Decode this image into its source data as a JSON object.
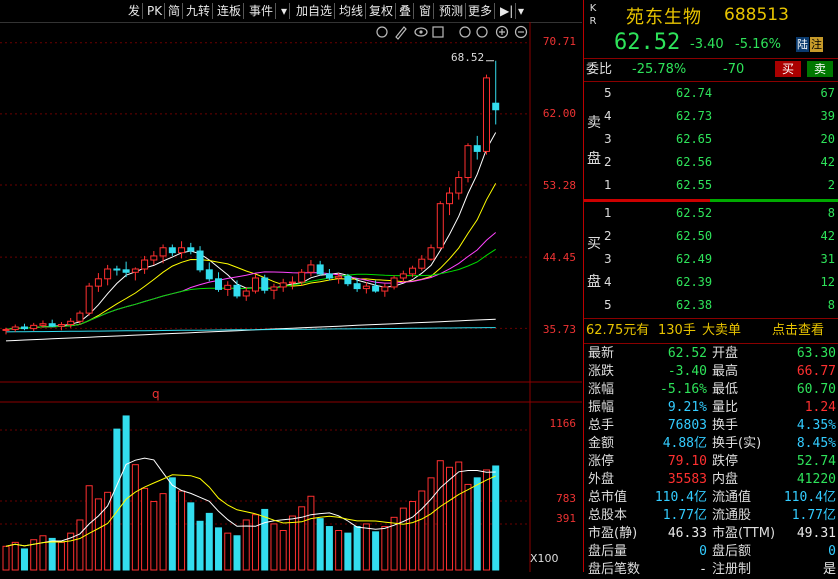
{
  "toolbar": {
    "items": [
      "发",
      "PK",
      "简",
      "九转",
      "连板",
      "事件",
      "▾",
      "加自选",
      "均线",
      "复权",
      "叠",
      "窗",
      "预测",
      "更多",
      "▶|",
      "▾"
    ]
  },
  "chart": {
    "price_ticks": [
      "70.71",
      "62.00",
      "53.28",
      "44.45",
      "35.73"
    ],
    "vol_ticks": [
      "1166",
      "783",
      "391"
    ],
    "high_label": "68.52",
    "q_marker": "q",
    "vol_unit": "X100"
  },
  "chart_data": {
    "type": "candlestick",
    "ylim": [
      31.0,
      73.0
    ],
    "candles": [
      [
        35.5,
        35.8,
        35.0,
        35.6
      ],
      [
        35.6,
        36.2,
        35.3,
        35.9
      ],
      [
        35.9,
        36.3,
        35.5,
        35.7
      ],
      [
        35.7,
        36.4,
        35.4,
        36.1
      ],
      [
        36.1,
        36.7,
        35.8,
        36.3
      ],
      [
        36.3,
        36.8,
        35.9,
        36.0
      ],
      [
        36.0,
        36.5,
        35.5,
        36.2
      ],
      [
        36.2,
        37.0,
        35.8,
        36.6
      ],
      [
        36.6,
        37.9,
        36.2,
        37.6
      ],
      [
        37.6,
        41.3,
        37.3,
        40.9
      ],
      [
        40.9,
        42.5,
        40.2,
        41.8
      ],
      [
        41.8,
        43.5,
        41.0,
        43.0
      ],
      [
        43.0,
        43.4,
        42.2,
        42.9
      ],
      [
        42.9,
        43.9,
        42.0,
        42.6
      ],
      [
        42.6,
        43.2,
        41.6,
        43.0
      ],
      [
        43.0,
        44.6,
        42.4,
        44.1
      ],
      [
        44.1,
        45.2,
        43.5,
        44.6
      ],
      [
        44.6,
        46.0,
        43.7,
        45.6
      ],
      [
        45.6,
        46.0,
        44.6,
        45.0
      ],
      [
        45.0,
        46.4,
        44.3,
        45.6
      ],
      [
        45.6,
        46.2,
        44.8,
        45.2
      ],
      [
        45.2,
        45.8,
        42.6,
        42.9
      ],
      [
        42.9,
        43.8,
        41.5,
        41.8
      ],
      [
        41.8,
        42.6,
        40.2,
        40.5
      ],
      [
        40.5,
        41.5,
        39.7,
        41.0
      ],
      [
        41.0,
        41.6,
        39.4,
        39.7
      ],
      [
        39.7,
        40.8,
        39.1,
        40.3
      ],
      [
        40.3,
        42.3,
        40.0,
        41.9
      ],
      [
        41.9,
        42.3,
        40.0,
        40.4
      ],
      [
        40.4,
        41.2,
        39.3,
        40.8
      ],
      [
        40.8,
        41.8,
        40.2,
        41.3
      ],
      [
        41.3,
        42.1,
        40.5,
        41.4
      ],
      [
        41.4,
        43.0,
        41.0,
        42.6
      ],
      [
        42.6,
        44.1,
        42.1,
        43.5
      ],
      [
        43.5,
        44.0,
        42.2,
        42.4
      ],
      [
        42.4,
        43.0,
        41.6,
        41.9
      ],
      [
        41.9,
        42.5,
        41.2,
        42.1
      ],
      [
        42.1,
        42.4,
        40.9,
        41.2
      ],
      [
        41.2,
        41.9,
        40.2,
        40.6
      ],
      [
        40.6,
        41.4,
        40.0,
        40.9
      ],
      [
        40.9,
        41.6,
        40.1,
        40.3
      ],
      [
        40.3,
        41.2,
        39.6,
        40.8
      ],
      [
        40.8,
        42.2,
        40.5,
        41.9
      ],
      [
        41.9,
        42.8,
        41.4,
        42.4
      ],
      [
        42.4,
        43.4,
        42.0,
        43.1
      ],
      [
        43.1,
        44.7,
        42.8,
        44.2
      ],
      [
        44.2,
        46.0,
        44.0,
        45.6
      ],
      [
        45.6,
        51.3,
        45.4,
        51.0
      ],
      [
        51.0,
        53.0,
        49.6,
        52.3
      ],
      [
        52.3,
        55.0,
        51.5,
        54.2
      ],
      [
        54.2,
        58.4,
        53.6,
        58.1
      ],
      [
        58.1,
        59.3,
        56.4,
        57.4
      ],
      [
        57.4,
        66.8,
        57.0,
        66.4
      ],
      [
        63.3,
        68.5,
        60.7,
        62.5
      ]
    ],
    "volumes": [
      180,
      210,
      160,
      230,
      260,
      240,
      210,
      280,
      380,
      640,
      540,
      590,
      1070,
      1170,
      800,
      620,
      520,
      580,
      700,
      600,
      510,
      370,
      430,
      320,
      280,
      260,
      380,
      420,
      460,
      350,
      300,
      410,
      480,
      560,
      390,
      330,
      300,
      280,
      330,
      350,
      290,
      330,
      400,
      470,
      520,
      600,
      700,
      830,
      780,
      820,
      650,
      700,
      760,
      790
    ],
    "ma5_color": "#ffffff",
    "ma10_color": "#ffff00",
    "ma20_color": "#ff44ff",
    "ma30_color": "#00dd00",
    "ma60_color": "#ffffff"
  },
  "panel": {
    "kr_label": "K R",
    "name": "苑东生物",
    "code": "688513",
    "price": "62.52",
    "change": "-3.40",
    "change_pct": "-5.16%",
    "badge_lu": "陆",
    "badge_zhu": "注",
    "weibi_label": "委比",
    "weibi_pct": "-25.78%",
    "weibi_val": "-70",
    "buy_btn": "买",
    "sell_btn": "卖",
    "sell_label_1": "卖",
    "sell_label_2": "盘",
    "buy_label_1": "买",
    "buy_label_2": "盘",
    "asks": [
      {
        "level": "5",
        "price": "62.74",
        "vol": "67"
      },
      {
        "level": "4",
        "price": "62.73",
        "vol": "39"
      },
      {
        "level": "3",
        "price": "62.65",
        "vol": "20"
      },
      {
        "level": "2",
        "price": "62.56",
        "vol": "42"
      },
      {
        "level": "1",
        "price": "62.55",
        "vol": "2"
      }
    ],
    "bids": [
      {
        "level": "1",
        "price": "62.52",
        "vol": "8"
      },
      {
        "level": "2",
        "price": "62.50",
        "vol": "42"
      },
      {
        "level": "3",
        "price": "62.49",
        "vol": "31"
      },
      {
        "level": "4",
        "price": "62.39",
        "vol": "12"
      },
      {
        "level": "5",
        "price": "62.38",
        "vol": "8"
      }
    ],
    "big_order_price": "62.75元有",
    "big_order_qty": "130手",
    "big_order_label": "大卖单",
    "big_order_action": "点击查看",
    "quote": [
      {
        "l1": "最新",
        "v1": "62.52",
        "c1": "green",
        "l2": "开盘",
        "v2": "63.30",
        "c2": "green"
      },
      {
        "l1": "涨跌",
        "v1": "-3.40",
        "c1": "green",
        "l2": "最高",
        "v2": "66.77",
        "c2": "red"
      },
      {
        "l1": "涨幅",
        "v1": "-5.16%",
        "c1": "green",
        "l2": "最低",
        "v2": "60.70",
        "c2": "green"
      },
      {
        "l1": "振幅",
        "v1": "9.21%",
        "c1": "cyan",
        "l2": "量比",
        "v2": "1.24",
        "c2": "red"
      },
      {
        "l1": "总手",
        "v1": "76803",
        "c1": "cyan",
        "l2": "换手",
        "v2": "4.35%",
        "c2": "cyan"
      },
      {
        "l1": "金额",
        "v1": "4.88亿",
        "c1": "cyan",
        "l2": "换手(实)",
        "v2": "8.45%",
        "c2": "cyan"
      },
      {
        "l1": "涨停",
        "v1": "79.10",
        "c1": "red",
        "l2": "跌停",
        "v2": "52.74",
        "c2": "green"
      },
      {
        "l1": "外盘",
        "v1": "35583",
        "c1": "red",
        "l2": "内盘",
        "v2": "41220",
        "c2": "green"
      },
      {
        "l1": "总市值",
        "v1": "110.4亿",
        "c1": "cyan",
        "l2": "流通值",
        "v2": "110.4亿",
        "c2": "cyan"
      },
      {
        "l1": "总股本",
        "v1": "1.77亿",
        "c1": "cyan",
        "l2": "流通股",
        "v2": "1.77亿",
        "c2": "cyan"
      },
      {
        "l1": "市盈(静)",
        "v1": "46.33",
        "c1": "white",
        "l2": "市盈(TTM)",
        "v2": "49.31",
        "c2": "white"
      },
      {
        "l1": "盘后量",
        "v1": "0",
        "c1": "cyan",
        "l2": "盘后额",
        "v2": "0",
        "c2": "cyan"
      },
      {
        "l1": "盘后笔数",
        "v1": "-",
        "c1": "white",
        "l2": "注册制",
        "v2": "是",
        "c2": "white"
      }
    ]
  }
}
